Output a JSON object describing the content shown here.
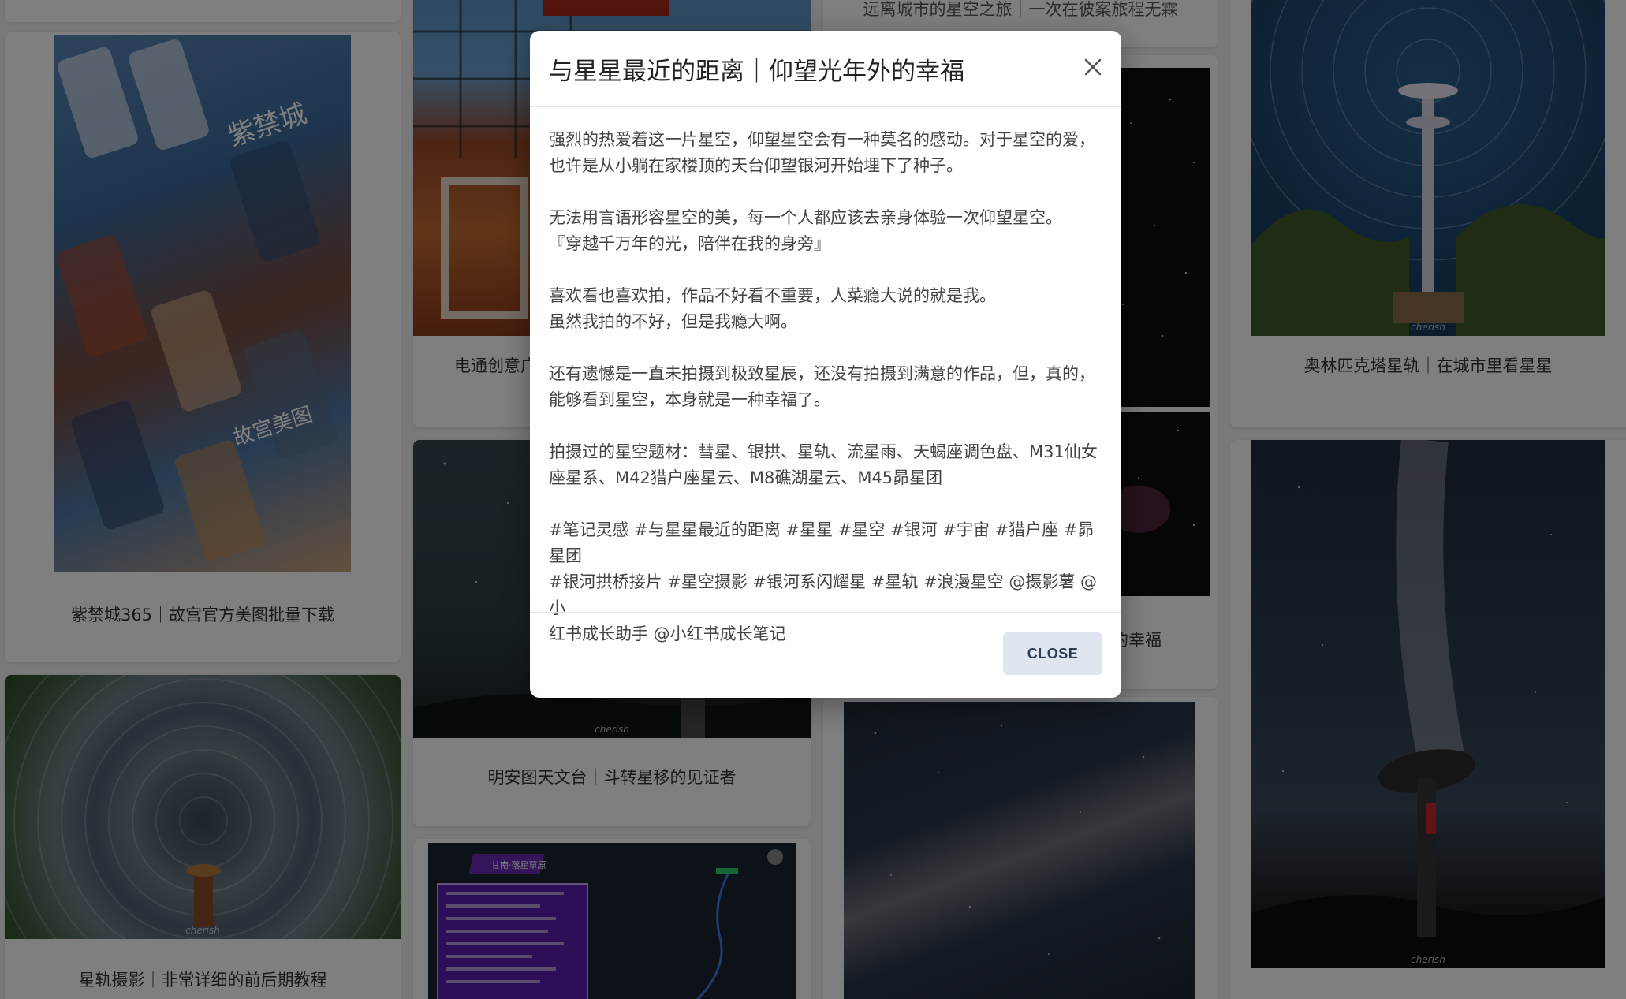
{
  "cards": {
    "forbidden_city": {
      "caption": "紫禁城365｜故宫官方美图批量下载"
    },
    "star_trail_tutorial": {
      "caption": "星轨摄影｜非常详细的前后期教程",
      "watermark": "cherish"
    },
    "dentsu": {
      "caption": "电通创意广"
    },
    "mingantu": {
      "caption": "明安图天文台｜斗转星移的见证者",
      "watermark": "cherish"
    },
    "far_city": {
      "caption": "远离城市的星空之旅｜一次在彼案旅程无霖"
    },
    "closest_distance": {
      "caption": "的幸福"
    },
    "olympic_tower": {
      "caption": "奥林匹克塔星轨｜在城市里看星星",
      "watermark": "cherish"
    },
    "radio_telescope": {
      "watermark": "cherish"
    },
    "map": {
      "header": "甘南·落星草原"
    }
  },
  "dialog": {
    "title": "与星星最近的距离｜仰望光年外的幸福",
    "paragraphs": [
      "强烈的热爱着这一片星空，仰望星空会有一种莫名的感动。对于星空的爱，\n也许是从小躺在家楼顶的天台仰望银河开始埋下了种子。",
      "无法用言语形容星空的美，每一个人都应该去亲身体验一次仰望星空。\n『穿越千万年的光，陪伴在我的身旁』",
      "喜欢看也喜欢拍，作品不好看不重要，人菜瘾大说的就是我。\n虽然我拍的不好，但是我瘾大啊。",
      "还有遗憾是一直未拍摄到极致星辰，还没有拍摄到满意的作品，但，真的，\n能够看到星空，本身就是一种幸福了。",
      "拍摄过的星空题材：彗星、银拱、星轨、流星雨、天蝎座调色盘、M31仙女\n座星系、M42猎户座星云、M8礁湖星云、M45昴星团",
      "#笔记灵感 #与星星最近的距离 #星星 #星空 #银河 #宇宙 #猎户座 #昴星团\n#银河拱桥接片 #星空摄影 #银河系闪耀星 #星轨 #浪漫星空 @摄影薯 @小\n红书成长助手 @小红书成长笔记"
    ],
    "close_button_label": "CLOSE"
  }
}
